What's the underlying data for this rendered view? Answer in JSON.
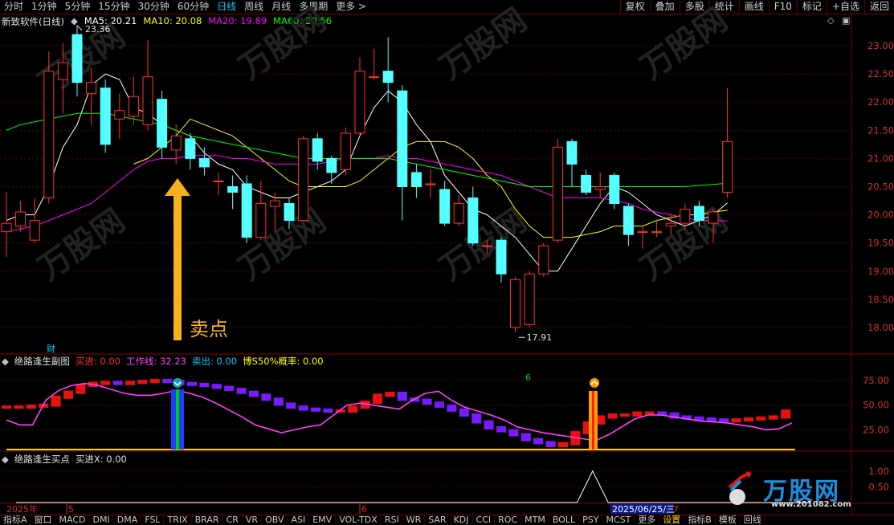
{
  "toolbar": {
    "tabs": [
      "分时",
      "1分钟",
      "5分钟",
      "15分钟",
      "30分钟",
      "60分钟",
      "日线",
      "周线",
      "月线",
      "多周期",
      "更多 >"
    ],
    "active_tab": "日线",
    "right_tabs": [
      "复权",
      "叠加",
      "多股",
      "统计",
      "画线",
      "F10",
      "标记",
      "+自选",
      "返回"
    ]
  },
  "main_panel": {
    "stock_title": "新致软件(日线)",
    "ma": [
      {
        "label": "MA5: 20.21",
        "color": "#ffffff"
      },
      {
        "label": "MA10: 20.08",
        "color": "#ffff00"
      },
      {
        "label": "MA20: 19.89",
        "color": "#ff00ff"
      },
      {
        "label": "MA60: 20.56",
        "color": "#00ff00"
      }
    ],
    "high_label": "23.36",
    "low_label": "17.91",
    "annotation": "卖点",
    "cai_marker": "财"
  },
  "sub_panel": {
    "title": "绝路逢生副图",
    "items": [
      {
        "label": "买进: 0.00",
        "color": "#ff3030"
      },
      {
        "label": "工作线: 32.23",
        "color": "#ff40ff"
      },
      {
        "label": "卖出: 0.00",
        "color": "#00c8ff"
      },
      {
        "label": "博S50%概率: 0.00",
        "color": "#ffff00"
      }
    ],
    "count_label": "6"
  },
  "signal_panel": {
    "title": "绝路逢生买点",
    "items": [
      {
        "label": "买进X: 0.00",
        "color": "#e0e0e0"
      }
    ]
  },
  "date_axis": {
    "year_label": "2025年",
    "month_labels": [
      "5",
      "6",
      "7"
    ],
    "cursor_date": "2025/06/25/三"
  },
  "bottom_tabs": [
    "指标A",
    "窗口",
    "MACD",
    "DMI",
    "DMA",
    "FSL",
    "TRIX",
    "BRAR",
    "CR",
    "VR",
    "OBV",
    "ASI",
    "EMV",
    "VOL-TDX",
    "RSI",
    "WR",
    "SAR",
    "KDJ",
    "CCI",
    "ROC",
    "MTM",
    "BOLL",
    "PSY",
    "MCST",
    "更多",
    "设置",
    "指标B",
    "模板",
    "回线"
  ],
  "active_bottom_tab": "设置",
  "logo_text": "万股网",
  "logo_url": "www.201082.com",
  "chart_data": [
    {
      "type": "candlestick",
      "title": "新致软件(日线)",
      "ylim": [
        17.6,
        23.3
      ],
      "y_ticks": [
        "23.00",
        "22.50",
        "22.00",
        "21.50",
        "21.00",
        "20.50",
        "20.00",
        "19.50",
        "19.00",
        "18.50",
        "18.00"
      ],
      "candles": [
        {
          "o": 19.7,
          "c": 19.85,
          "h": 20.4,
          "l": 19.25
        },
        {
          "o": 19.8,
          "c": 20.05,
          "h": 20.25,
          "l": 19.7
        },
        {
          "o": 19.55,
          "c": 19.9,
          "h": 20.3,
          "l": 19.5
        },
        {
          "o": 20.3,
          "c": 22.55,
          "h": 22.9,
          "l": 20.2
        },
        {
          "o": 22.4,
          "c": 22.7,
          "h": 23.05,
          "l": 21.8
        },
        {
          "o": 23.2,
          "c": 22.35,
          "h": 23.36,
          "l": 22.1
        },
        {
          "o": 22.15,
          "c": 22.35,
          "h": 22.6,
          "l": 21.6
        },
        {
          "o": 22.25,
          "c": 21.25,
          "h": 22.4,
          "l": 21.1
        },
        {
          "o": 21.7,
          "c": 21.85,
          "h": 22.15,
          "l": 21.35
        },
        {
          "o": 21.75,
          "c": 22.1,
          "h": 22.45,
          "l": 21.6
        },
        {
          "o": 21.6,
          "c": 22.45,
          "h": 23.1,
          "l": 21.5
        },
        {
          "o": 22.05,
          "c": 21.2,
          "h": 22.2,
          "l": 21.0
        },
        {
          "o": 21.15,
          "c": 21.4,
          "h": 21.6,
          "l": 20.9
        },
        {
          "o": 21.35,
          "c": 21.0,
          "h": 21.45,
          "l": 20.8
        },
        {
          "o": 21.0,
          "c": 20.85,
          "h": 21.2,
          "l": 20.7
        },
        {
          "o": 20.6,
          "c": 20.6,
          "h": 20.75,
          "l": 20.35
        },
        {
          "o": 20.5,
          "c": 20.4,
          "h": 20.7,
          "l": 20.1
        },
        {
          "o": 20.55,
          "c": 19.6,
          "h": 20.7,
          "l": 19.5
        },
        {
          "o": 19.6,
          "c": 20.2,
          "h": 20.6,
          "l": 19.55
        },
        {
          "o": 20.15,
          "c": 20.25,
          "h": 20.4,
          "l": 19.7
        },
        {
          "o": 20.2,
          "c": 19.9,
          "h": 20.3,
          "l": 19.75
        },
        {
          "o": 19.9,
          "c": 21.35,
          "h": 21.4,
          "l": 19.9
        },
        {
          "o": 21.35,
          "c": 20.95,
          "h": 21.45,
          "l": 20.8
        },
        {
          "o": 21.0,
          "c": 20.75,
          "h": 21.05,
          "l": 20.55
        },
        {
          "o": 20.8,
          "c": 21.45,
          "h": 21.55,
          "l": 20.7
        },
        {
          "o": 21.45,
          "c": 22.55,
          "h": 22.8,
          "l": 21.4
        },
        {
          "o": 22.45,
          "c": 22.45,
          "h": 22.95,
          "l": 22.4
        },
        {
          "o": 22.55,
          "c": 22.35,
          "h": 23.15,
          "l": 22.0
        },
        {
          "o": 22.2,
          "c": 20.5,
          "h": 22.3,
          "l": 19.9
        },
        {
          "o": 20.75,
          "c": 20.5,
          "h": 20.9,
          "l": 20.3
        },
        {
          "o": 20.55,
          "c": 20.55,
          "h": 20.8,
          "l": 20.3
        },
        {
          "o": 20.45,
          "c": 19.85,
          "h": 20.6,
          "l": 19.8
        },
        {
          "o": 19.85,
          "c": 20.2,
          "h": 20.35,
          "l": 19.8
        },
        {
          "o": 20.3,
          "c": 19.5,
          "h": 20.5,
          "l": 19.45
        },
        {
          "o": 19.45,
          "c": 19.45,
          "h": 19.55,
          "l": 19.3
        },
        {
          "o": 19.55,
          "c": 18.95,
          "h": 19.6,
          "l": 18.8
        },
        {
          "o": 18.0,
          "c": 18.85,
          "h": 18.9,
          "l": 17.91
        },
        {
          "o": 18.05,
          "c": 18.95,
          "h": 19.0,
          "l": 18.0
        },
        {
          "o": 18.95,
          "c": 19.45,
          "h": 19.5,
          "l": 18.9
        },
        {
          "o": 19.55,
          "c": 21.2,
          "h": 21.35,
          "l": 19.5
        },
        {
          "o": 21.3,
          "c": 20.9,
          "h": 21.35,
          "l": 20.5
        },
        {
          "o": 20.7,
          "c": 20.4,
          "h": 20.8,
          "l": 20.35
        },
        {
          "o": 20.45,
          "c": 20.5,
          "h": 20.75,
          "l": 20.3
        },
        {
          "o": 20.7,
          "c": 20.2,
          "h": 20.75,
          "l": 20.1
        },
        {
          "o": 20.15,
          "c": 19.65,
          "h": 20.2,
          "l": 19.45
        },
        {
          "o": 19.7,
          "c": 19.7,
          "h": 19.8,
          "l": 19.4
        },
        {
          "o": 19.7,
          "c": 19.7,
          "h": 19.9,
          "l": 19.6
        },
        {
          "o": 19.8,
          "c": 19.85,
          "h": 20.0,
          "l": 19.65
        },
        {
          "o": 19.85,
          "c": 20.1,
          "h": 20.2,
          "l": 19.75
        },
        {
          "o": 20.15,
          "c": 19.9,
          "h": 20.25,
          "l": 19.8
        },
        {
          "o": 19.85,
          "c": 20.05,
          "h": 20.1,
          "l": 19.5
        },
        {
          "o": 20.4,
          "c": 21.3,
          "h": 22.25,
          "l": 20.3
        }
      ],
      "ma_series": [
        {
          "name": "MA5",
          "color": "#ffffff",
          "values": [
            19.9,
            20.0,
            20.0,
            20.5,
            21.2,
            21.6,
            22.3,
            22.5,
            22.4,
            21.9,
            21.8,
            21.6,
            21.5,
            21.4,
            21.1,
            20.9,
            20.8,
            20.5,
            20.4,
            20.3,
            20.3,
            20.4,
            20.5,
            20.6,
            20.8,
            21.4,
            21.9,
            22.2,
            22.0,
            21.6,
            21.3,
            20.7,
            20.4,
            20.1,
            20.0,
            19.8,
            19.6,
            19.3,
            19.0,
            19.0,
            19.4,
            19.8,
            20.2,
            20.5,
            20.4,
            20.2,
            20.0,
            19.9,
            19.8,
            19.9,
            20.0,
            20.21
          ]
        },
        {
          "name": "MA10",
          "color": "#ffff00",
          "values": [
            null,
            null,
            null,
            null,
            null,
            null,
            null,
            null,
            null,
            20.9,
            21.0,
            21.2,
            21.4,
            21.7,
            21.6,
            21.5,
            21.4,
            21.2,
            21.0,
            20.8,
            20.6,
            20.5,
            20.5,
            20.5,
            20.5,
            20.6,
            20.8,
            21.0,
            21.2,
            21.3,
            21.3,
            21.3,
            21.2,
            21.0,
            20.7,
            20.5,
            20.1,
            19.8,
            19.6,
            19.6,
            19.6,
            19.65,
            19.7,
            19.8,
            19.8,
            19.8,
            19.9,
            19.95,
            20.0,
            20.0,
            20.05,
            20.08
          ]
        },
        {
          "name": "MA20",
          "color": "#ff00ff",
          "values": [
            19.7,
            19.75,
            19.8,
            19.9,
            20.0,
            20.1,
            20.2,
            20.4,
            20.6,
            20.8,
            20.95,
            21.0,
            21.0,
            21.05,
            21.05,
            21.05,
            21.0,
            21.0,
            20.95,
            20.9,
            20.9,
            20.9,
            20.9,
            20.95,
            21.0,
            21.0,
            21.0,
            21.05,
            21.0,
            21.0,
            20.95,
            20.9,
            20.85,
            20.8,
            20.75,
            20.7,
            20.6,
            20.5,
            20.4,
            20.3,
            20.3,
            20.3,
            20.3,
            20.25,
            20.2,
            20.1,
            20.05,
            20.0,
            19.95,
            19.9,
            19.9,
            19.89
          ]
        },
        {
          "name": "MA60",
          "color": "#00ff00",
          "values": [
            21.5,
            21.6,
            21.65,
            21.7,
            21.75,
            21.8,
            21.8,
            21.8,
            21.75,
            21.7,
            21.65,
            21.6,
            21.5,
            21.4,
            21.35,
            21.3,
            21.25,
            21.2,
            21.15,
            21.1,
            21.05,
            21.0,
            21.0,
            21.0,
            21.0,
            21.0,
            21.0,
            21.0,
            20.95,
            20.9,
            20.85,
            20.8,
            20.75,
            20.7,
            20.65,
            20.6,
            20.55,
            20.5,
            20.5,
            20.5,
            20.5,
            20.5,
            20.5,
            20.5,
            20.5,
            20.5,
            20.5,
            20.5,
            20.5,
            20.52,
            20.54,
            20.56
          ]
        }
      ]
    },
    {
      "type": "bar",
      "title": "绝路逢生副图",
      "ylim": [
        5,
        88
      ],
      "y_ticks": [
        "75.00",
        "50.00",
        "25.00"
      ],
      "values": [
        48,
        48,
        49,
        50,
        58,
        63,
        70,
        72,
        73,
        72,
        73,
        74,
        75,
        74,
        72,
        71,
        70,
        68,
        66,
        63,
        60,
        56,
        51,
        48,
        46,
        45,
        44,
        44,
        48,
        53,
        60,
        62,
        56,
        55,
        52,
        49,
        45,
        40,
        33,
        27,
        24,
        20,
        15,
        12,
        9,
        11,
        22,
        32,
        38,
        40,
        40,
        42,
        42,
        41,
        38,
        37,
        36,
        35,
        34,
        35,
        36,
        37,
        38,
        44
      ],
      "work_line": [
        35,
        30,
        30,
        55,
        65,
        70,
        72,
        70,
        66,
        62,
        60,
        60,
        62,
        65,
        62,
        58,
        52,
        45,
        38,
        30,
        26,
        22,
        25,
        28,
        30,
        40,
        50,
        52,
        50,
        48,
        46,
        55,
        62,
        64,
        55,
        48,
        44,
        40,
        35,
        28,
        25,
        22,
        20,
        18,
        16,
        14,
        20,
        28,
        36,
        40,
        40,
        38,
        36,
        34,
        33,
        32,
        30,
        28,
        25,
        26,
        32
      ],
      "work_line_label": "工作线: 32.23"
    },
    {
      "type": "line",
      "title": "绝路逢生买点",
      "ylim": [
        0,
        1.3
      ],
      "y_ticks": [
        "1.00",
        "0.50"
      ],
      "series": [
        {
          "name": "买进X",
          "values": [
            0,
            0,
            0,
            0,
            0,
            0,
            0,
            0,
            0,
            0,
            0,
            0,
            0,
            0,
            0,
            0,
            0,
            0,
            0,
            0,
            0,
            0,
            0,
            0,
            0,
            0,
            0,
            0,
            0,
            0,
            0,
            0,
            0,
            0,
            0,
            0,
            0,
            1,
            0,
            0,
            0,
            0,
            0,
            0,
            0,
            0,
            0,
            0,
            0,
            0,
            0,
            0
          ]
        }
      ]
    }
  ]
}
